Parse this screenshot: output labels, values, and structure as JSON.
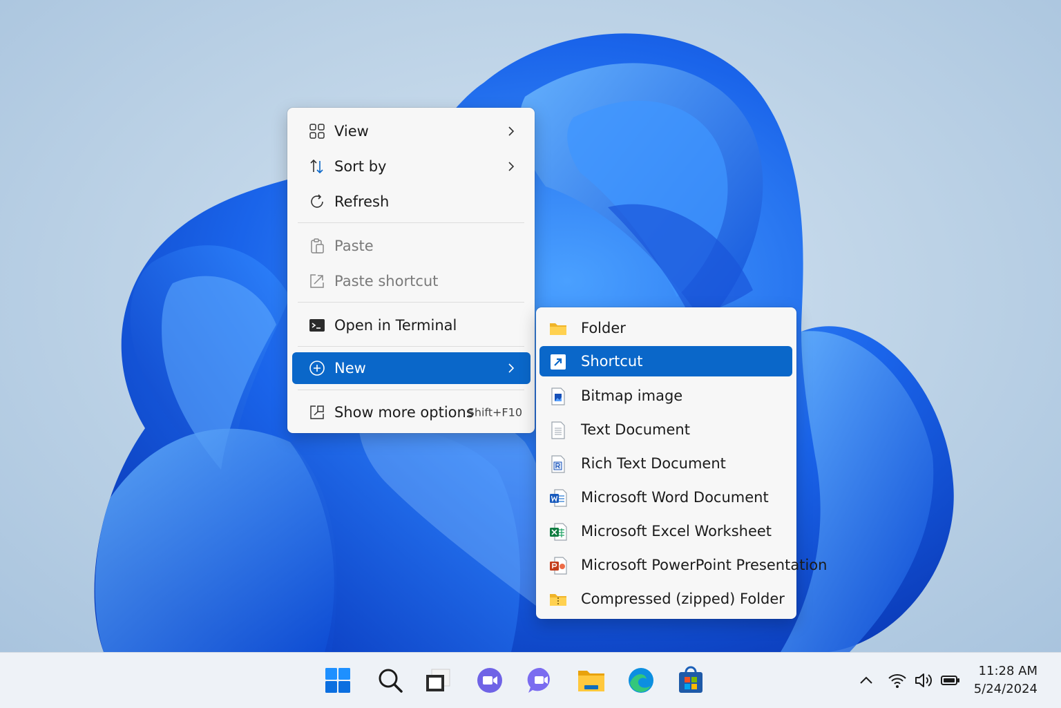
{
  "context_menu": {
    "items": [
      {
        "label": "View",
        "icon": "view-grid-icon"
      },
      {
        "label": "Sort by",
        "icon": "sort-icon"
      },
      {
        "label": "Refresh",
        "icon": "refresh-icon"
      },
      {
        "label": "Paste",
        "icon": "paste-icon"
      },
      {
        "label": "Paste shortcut",
        "icon": "paste-shortcut-icon"
      },
      {
        "label": "Open in Terminal",
        "icon": "terminal-icon"
      },
      {
        "label": "New",
        "icon": "new-plus-icon"
      },
      {
        "label": "Show more options",
        "icon": "more-options-icon",
        "shortcut": "Shift+F10"
      }
    ]
  },
  "new_submenu": {
    "items": [
      {
        "label": "Folder",
        "icon": "folder-icon"
      },
      {
        "label": "Shortcut",
        "icon": "shortcut-icon"
      },
      {
        "label": "Bitmap image",
        "icon": "bitmap-icon"
      },
      {
        "label": "Text Document",
        "icon": "text-document-icon"
      },
      {
        "label": "Rich Text Document",
        "icon": "rich-text-icon"
      },
      {
        "label": "Microsoft Word Document",
        "icon": "word-icon"
      },
      {
        "label": "Microsoft Excel Worksheet",
        "icon": "excel-icon"
      },
      {
        "label": "Microsoft PowerPoint Presentation",
        "icon": "powerpoint-icon"
      },
      {
        "label": "Compressed (zipped) Folder",
        "icon": "zip-folder-icon"
      }
    ]
  },
  "taskbar": {
    "apps": [
      "start-icon",
      "search-icon",
      "task-view-icon",
      "teams-icon",
      "chat-icon",
      "file-explorer-icon",
      "edge-icon",
      "store-icon"
    ],
    "tray": [
      "chevron-up-icon",
      "wifi-icon",
      "volume-icon",
      "battery-icon"
    ],
    "time": "11:28 AM",
    "date": "5/24/2024"
  },
  "colors": {
    "accent": "#0a67c9",
    "menu_bg": "#f7f7f7",
    "taskbar_bg": "#eef2f7"
  }
}
